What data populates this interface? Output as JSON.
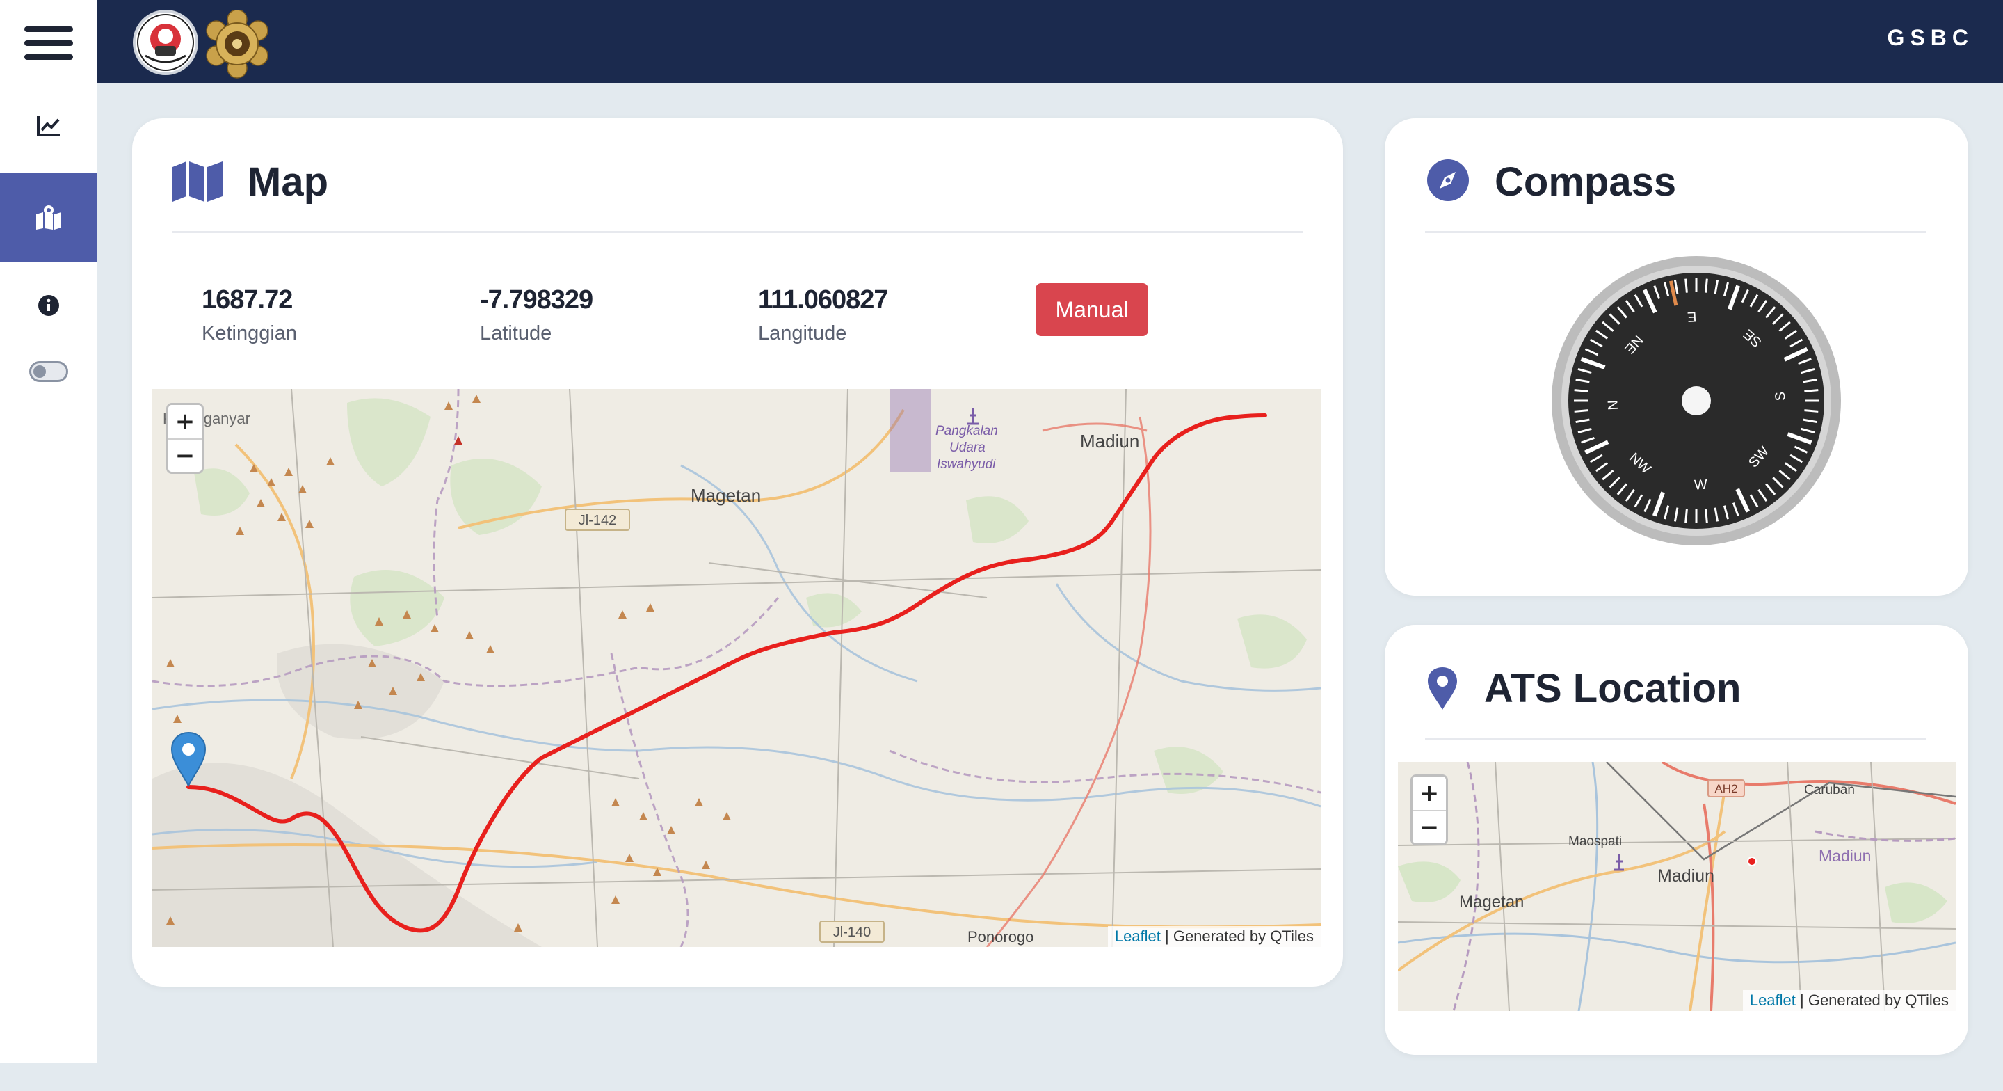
{
  "header": {
    "brand": "GSBC"
  },
  "sidebar": {
    "items": [
      "menu-icon",
      "chart-line-icon",
      "map-marked-icon",
      "info-icon",
      "theme-toggle"
    ],
    "active_index": 2,
    "accent": "#4e5ca9"
  },
  "map_card": {
    "title": "Map",
    "stats": [
      {
        "value": "1687.72",
        "label": "Ketinggian"
      },
      {
        "value": "-7.798329",
        "label": "Latitude"
      },
      {
        "value": "111.060827",
        "label": "Langitude"
      }
    ],
    "mode_button": "Manual",
    "map": {
      "places": [
        "Karanganyar",
        "Magetan",
        "Madiun",
        "Pangkalan",
        "Udara",
        "Iswahyudi",
        "Ponorogo"
      ],
      "roads": [
        "Jl-142",
        "Jl-140"
      ],
      "attribution_link": "Leaflet",
      "attribution_text": " | Generated by QTiles",
      "zoom_in": "+",
      "zoom_out": "−"
    }
  },
  "compass_card": {
    "title": "Compass",
    "dial_labels": [
      "SE",
      "S",
      "SW",
      "W",
      "NW",
      "N",
      "NE",
      "E"
    ]
  },
  "ats_card": {
    "title": "ATS Location",
    "map": {
      "places": [
        "Magetan",
        "Madiun",
        "Maospati",
        "Caruban",
        "Madiun"
      ],
      "roads": [
        "AH2"
      ],
      "attribution_link": "Leaflet",
      "attribution_text": " | Generated by QTiles",
      "zoom_in": "+",
      "zoom_out": "−"
    }
  },
  "colors": {
    "header": "#1b2a4e",
    "accent": "#4e5ca9",
    "danger": "#d9454e",
    "track": "#e8201d"
  }
}
